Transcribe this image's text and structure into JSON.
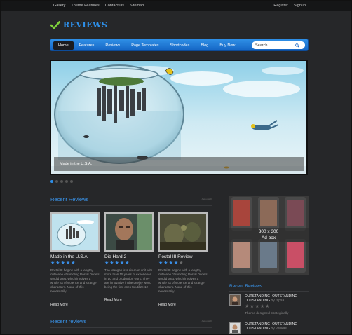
{
  "topbar": {
    "left_links": [
      "Gallery",
      "Theme Features",
      "Contact Us",
      "Sitemap"
    ],
    "right_links": [
      "Register",
      "Sign In"
    ]
  },
  "logo": {
    "text": "REVIEWS",
    "icon": "checkmark-icon",
    "color": "#2e8fe8"
  },
  "nav": {
    "items": [
      "Home",
      "Features",
      "Reviews",
      "Page Templates",
      "Shortcodes",
      "Blog",
      "Buy Now"
    ],
    "active": "Home",
    "search_placeholder": "Search",
    "accent": "#1e78d6"
  },
  "slider": {
    "caption": "Made in the U.S.A.",
    "slides": 5,
    "active_slide": 1
  },
  "recent_reviews": {
    "title": "Recent Reviews",
    "view_all": "View All",
    "cards": [
      {
        "title": "Made in the U.S.A.",
        "rating": 5,
        "text": "Postal III begins with a lengthy cutscene chronicling Postal Dude's sordid past, which involves a whole lot of violence and strange characters. None of this necessarily",
        "read_more": "Read More"
      },
      {
        "title": "Die Hard 2",
        "rating": 5,
        "text": "The Mangan is a six-man unit with more than 15 years of experience in DJ and production work. They are innovative in the deejay world being the first ones to utilize 12",
        "read_more": "Read More"
      },
      {
        "title": "Postal III Review",
        "rating": 4,
        "text": "Postal III begins with a lengthy cutscene chronicling Postal Dude's sordid past, which involves a whole lot of violence and strange characters. None of this necessarily",
        "read_more": "Read More"
      }
    ]
  },
  "recent_reviews_2": {
    "title": "Recent reviews",
    "view_all": "View All"
  },
  "sidebar": {
    "ad": {
      "size": "300 x 300",
      "label": "Ad box"
    },
    "recent_title": "Recent Reviews",
    "items": [
      {
        "title": "OUTSTANDING- OUTSTANDING- OUTSTANDING",
        "by": "by",
        "author": "fapsa",
        "rating": 0,
        "note": "Theme designed strategically"
      },
      {
        "title": "OUTSTANDING- OUTSTANDING- OUTSTANDING",
        "by": "by",
        "author": "venkas"
      }
    ]
  }
}
